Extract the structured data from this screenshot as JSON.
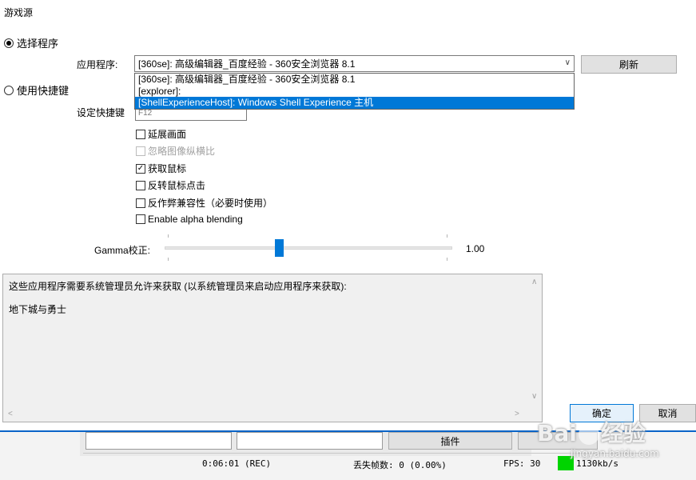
{
  "window": {
    "title": "游戏源"
  },
  "source_mode": {
    "select_program_label": "选择程序",
    "use_hotkey_label": "使用快捷键"
  },
  "app": {
    "label": "应用程序:",
    "selected": "[360se]: 高级编辑器_百度经验 - 360安全浏览器 8.1",
    "options": [
      "[360se]: 高级编辑器_百度经验 - 360安全浏览器 8.1",
      "[explorer]:",
      "[ShellExperienceHost]: Windows Shell Experience 主机"
    ],
    "refresh_label": "刷新"
  },
  "hotkey": {
    "label": "设定快捷键",
    "value": "F12"
  },
  "options": {
    "stretch": "延展画面",
    "ignore_aspect": "忽略图像纵横比",
    "capture_mouse": "获取鼠标",
    "invert_mouse": "反转鼠标点击",
    "anticheat": "反作弊兼容性（必要时使用）",
    "alpha": "Enable alpha blending"
  },
  "gamma": {
    "label": "Gamma校正:",
    "value": "1.00"
  },
  "info": {
    "message": "这些应用程序需要系统管理员允许来获取 (以系统管理员来启动应用程序来获取):",
    "apps": [
      "地下城与勇士"
    ]
  },
  "buttons": {
    "ok": "确定",
    "cancel": "取消"
  },
  "background_window": {
    "plugins_label": "插件",
    "time": "0:06:01 (REC)",
    "dropped": "丢失帧数: 0 (0.00%)",
    "fps": "FPS: 30",
    "bitrate": "1130kb/s"
  },
  "watermark": {
    "brand": "Bai",
    "brand2": "经验",
    "url": "jingyan.baidu.com"
  },
  "colors": {
    "accent": "#0078d7",
    "bitrate_indicator": "#00d400"
  }
}
